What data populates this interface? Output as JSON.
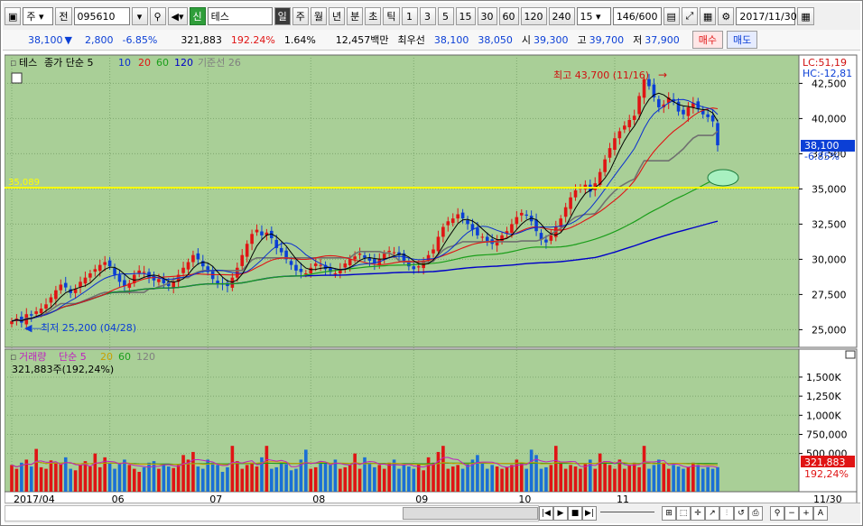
{
  "toolbar": {
    "market": "주",
    "prev_label": "전",
    "code": "095610",
    "name_badge": "신",
    "stock_name": "테스",
    "periods": [
      "일",
      "주",
      "월",
      "년"
    ],
    "intraday": [
      "분",
      "초",
      "틱"
    ],
    "intervals": [
      "1",
      "3",
      "5",
      "15",
      "30",
      "60",
      "120",
      "240"
    ],
    "interval_value": "15",
    "count": "146/600",
    "date": "2017/11/30"
  },
  "quote": {
    "price": "38,100",
    "arrow": "▼",
    "change": "2,800",
    "change_pct": "-6.85%",
    "volume": "321,883",
    "volume_ratio": "192.24%",
    "turnover": "1.64%",
    "amount": "12,457백만",
    "prior_label": "최우선",
    "bid1": "38,100",
    "bid2": "38,050",
    "high_label": "시",
    "open": "39,300",
    "hi_label": "고",
    "high": "39,700",
    "lo_label": "저",
    "low": "37,900",
    "buy_label": "매수",
    "sell_label": "매도"
  },
  "price_panel": {
    "title": "테스",
    "legend": [
      {
        "label": "종가 단순 5",
        "color": "#000000"
      },
      {
        "label": "10",
        "color": "#0a2fd0"
      },
      {
        "label": "20",
        "color": "#e01414"
      },
      {
        "label": "60",
        "color": "#1a9e1a"
      },
      {
        "label": "120",
        "color": "#0000c8"
      },
      {
        "label": "기준선 26",
        "color": "#808080"
      }
    ],
    "lc": "LC:51,19",
    "hc": "HC:-12,81",
    "high_note": "최고 43,700 (11/16)",
    "low_note": "최저 25,200 (04/28)",
    "support": "35,089",
    "current_price": "38,100",
    "current_pct": "-6.85%",
    "yaxis": [
      "42,500",
      "40,000",
      "37,500",
      "35,000",
      "32,500",
      "30,000",
      "27,500",
      "25,000"
    ]
  },
  "volume_panel": {
    "legend": [
      {
        "label": "거래량",
        "color": "#c020c0"
      },
      {
        "label": "단순 5",
        "color": "#c020c0"
      },
      {
        "label": "20",
        "color": "#c8a000"
      },
      {
        "label": "60",
        "color": "#1a9e1a"
      },
      {
        "label": "120",
        "color": "#808080"
      }
    ],
    "info": "321,883주(192,24%)",
    "yaxis": [
      "1,500K",
      "1,250K",
      "1,000K",
      "750,000",
      "500,000"
    ],
    "current": "321,883",
    "current_pct": "192,24%"
  },
  "xaxis": [
    "2017/04",
    "06",
    "07",
    "08",
    "09",
    "10",
    "11"
  ],
  "xaxis_end": "11/30",
  "chart_data": {
    "type": "candlestick",
    "ylim": [
      24000,
      44000
    ],
    "support_line": 35089,
    "high": {
      "value": 43700,
      "date": "11/16"
    },
    "low": {
      "value": 25200,
      "date": "04/28"
    },
    "last_close": 38100,
    "closes": [
      25600,
      25800,
      25500,
      26100,
      26000,
      26300,
      26500,
      26800,
      27300,
      27800,
      28200,
      28000,
      27600,
      27900,
      28400,
      28700,
      29000,
      29300,
      29600,
      29800,
      29500,
      28900,
      28400,
      28100,
      28300,
      28900,
      29200,
      29100,
      28700,
      28500,
      28600,
      28300,
      28100,
      28400,
      28900,
      29400,
      29800,
      30300,
      30000,
      29500,
      29100,
      28600,
      28300,
      28200,
      28100,
      28700,
      29400,
      30300,
      31100,
      31800,
      32100,
      31700,
      31900,
      31500,
      30800,
      30500,
      30000,
      29600,
      29200,
      29100,
      29000,
      29400,
      29700,
      29600,
      29300,
      29100,
      29000,
      29300,
      29700,
      30000,
      30200,
      30400,
      30100,
      29900,
      29700,
      30000,
      30400,
      30600,
      30500,
      30300,
      29900,
      29500,
      29300,
      29500,
      29900,
      30300,
      30700,
      31600,
      32300,
      32700,
      32900,
      33200,
      32900,
      32500,
      32100,
      31700,
      31600,
      31300,
      31100,
      31300,
      31700,
      32000,
      32500,
      33000,
      33300,
      33100,
      32700,
      32000,
      31400,
      31200,
      31700,
      32300,
      32900,
      33700,
      34400,
      34900,
      35100,
      35300,
      34800,
      35400,
      36200,
      37100,
      37900,
      38600,
      39100,
      39500,
      39900,
      40200,
      41600,
      42800,
      42300,
      41500,
      40800,
      41000,
      41500,
      41200,
      40500,
      40300,
      40800,
      41100,
      40700,
      40300,
      40100,
      39800,
      38100
    ],
    "volume_k": [
      350,
      300,
      380,
      420,
      330,
      560,
      320,
      300,
      410,
      380,
      360,
      450,
      300,
      280,
      350,
      400,
      330,
      500,
      320,
      450,
      380,
      300,
      360,
      420,
      350,
      300,
      260,
      320,
      380,
      400,
      300,
      360,
      330,
      310,
      350,
      480,
      420,
      520,
      330,
      300,
      420,
      380,
      350,
      260,
      320,
      600,
      400,
      300,
      350,
      380,
      330,
      450,
      600,
      300,
      320,
      380,
      360,
      280,
      300,
      420,
      550,
      300,
      320,
      400,
      380,
      350,
      420,
      300,
      320,
      350,
      500,
      300,
      450,
      380,
      320,
      350,
      300,
      380,
      420,
      300,
      350,
      330,
      300,
      360,
      280,
      450,
      380,
      520,
      600,
      300,
      330,
      350,
      300,
      360,
      420,
      480,
      380,
      300,
      350,
      330,
      300,
      320,
      350,
      420,
      380,
      300,
      550,
      480,
      300,
      320,
      350,
      600,
      380,
      300,
      350,
      330,
      300,
      360,
      420,
      300,
      500,
      400,
      350,
      300,
      420,
      300,
      350,
      380,
      320,
      600,
      300,
      350,
      420,
      380,
      300,
      350,
      330,
      300,
      320,
      380,
      350,
      300,
      320,
      300,
      321
    ]
  }
}
